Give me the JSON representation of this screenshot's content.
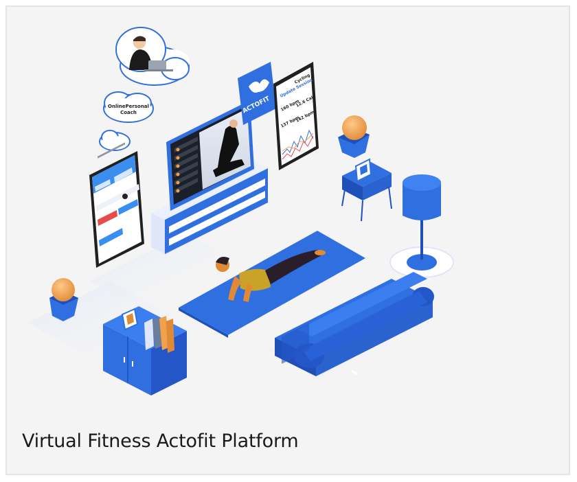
{
  "caption": "Virtual Fitness Actofit Platform",
  "cloud_label": "OnlinePersonal Coach",
  "brand": {
    "name": "ACTOFIT",
    "color": "#2f6fe0"
  },
  "phone_right": {
    "header": "Cycling",
    "section_title": "Update Session",
    "stats": [
      "160 bpm",
      "12.6 Cal",
      "137 bpm",
      "142 bpm"
    ]
  },
  "colors": {
    "primary_blue": "#2f6fe0",
    "dark_blue": "#1f4fb8",
    "light_blue": "#cfe0ff",
    "orange": "#f0a14a",
    "background": "#f4f4f4"
  },
  "icons": [
    "cloud-icon",
    "phone-icon",
    "monitor-icon",
    "lamp-icon",
    "sofa-icon",
    "yoga-mat-icon"
  ]
}
